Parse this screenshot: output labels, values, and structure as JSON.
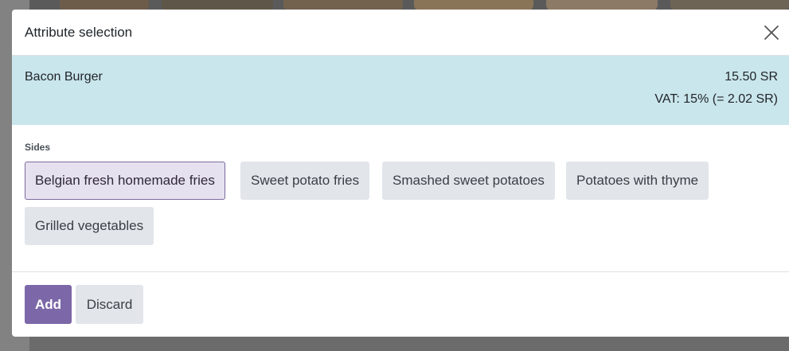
{
  "dialog": {
    "title": "Attribute selection",
    "close_icon": "close-icon"
  },
  "product": {
    "name": "Bacon Burger",
    "price": "15.50 SR",
    "vat": "VAT: 15% (= 2.02 SR)"
  },
  "attribute": {
    "label": "Sides",
    "selected_index": 0,
    "options": [
      "Belgian fresh homemade fries",
      "Sweet potato fries",
      "Smashed sweet potatoes",
      "Potatoes with thyme",
      "Grilled vegetables"
    ]
  },
  "footer": {
    "add_label": "Add",
    "discard_label": "Discard"
  },
  "colors": {
    "accent": "#7c68a8",
    "product_band": "#c9e6ec",
    "option_bg": "#e2e5ea",
    "option_selected_bg": "#e6e1ef"
  }
}
